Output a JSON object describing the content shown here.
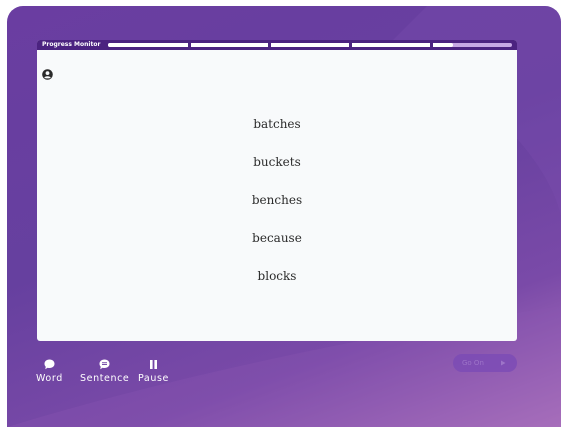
{
  "header": {
    "progress_label": "Progress Monitor",
    "progress_fraction": 0.855,
    "segments": 5
  },
  "words": [
    "batches",
    "buckets",
    "benches",
    "because",
    "blocks"
  ],
  "controls": {
    "word_label": "Word",
    "sentence_label": "Sentence",
    "pause_label": "Pause"
  },
  "go_on": {
    "label": "Go On"
  },
  "colors": {
    "background": "#6a3da1",
    "header": "#4b2380",
    "card": "#f8fafb",
    "track": "#c6a8e4"
  },
  "icons": {
    "account": "account-circle-icon",
    "word": "speech-bubble-icon",
    "sentence": "chat-bubble-icon",
    "pause": "pause-icon",
    "go_on": "play-arrow-icon"
  }
}
